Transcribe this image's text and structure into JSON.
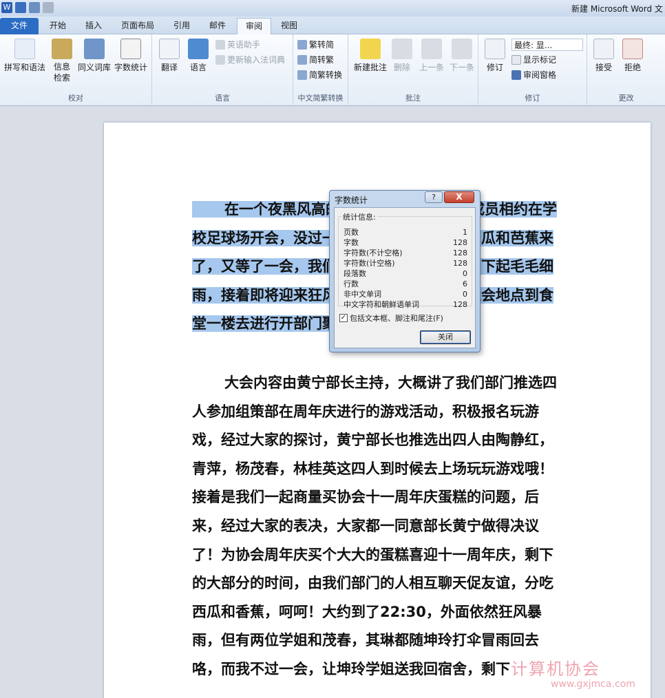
{
  "window": {
    "title": "新建 Microsoft Word 文",
    "app_icon": "W"
  },
  "tabs": [
    "文件",
    "开始",
    "插入",
    "页面布局",
    "引用",
    "邮件",
    "审阅",
    "视图"
  ],
  "ribbon": {
    "proofing": {
      "label": "校对",
      "spelling": "拼写和语法",
      "research": "信息\n检索",
      "thesaurus": "同义词库",
      "wordcount": "字数统计"
    },
    "language": {
      "label": "语言",
      "translate": "翻译",
      "language": "语言",
      "english_assistant": "英语助手",
      "update_ime": "更新输入法词典"
    },
    "chinese": {
      "label": "中文简繁转换",
      "trad_to_simp": "繁转简",
      "simp_to_trad": "简转繁",
      "convert": "简繁转换"
    },
    "comments": {
      "label": "批注",
      "new": "新建批注",
      "delete": "删除",
      "prev": "上一条",
      "next": "下一条"
    },
    "tracking": {
      "label": "修订",
      "track": "修订",
      "final": "最终: 显...",
      "show_markup": "显示标记",
      "review_pane": "审阅窗格"
    },
    "changes": {
      "label": "更改",
      "accept": "接受",
      "reject": "拒绝"
    }
  },
  "document": {
    "p1": "在一个夜黑风高的晚上，我们部门部门成员相约在学校足球场开会，没过一会儿，部长黄宁提着西瓜和芭蕉来了，又等了一会，我们部门人都到齐了，天空下起毛毛细雨，接着即将迎来狂风暴雨，部长临时改变聚会地点到食堂一楼去进行开部门聚会开会。",
    "p2": "大会内容由黄宁部长主持，大概讲了我们部门推选四人参加组策部在周年庆进行的游戏活动，积极报名玩游戏，经过大家的探讨，黄宁部长也推选出四人由陶静红，青萍，杨茂春，林桂英这四人到时候去上场玩玩游戏哦！接着是我们一起商量买协会十一周年庆蛋糕的问题，后来，经过大家的表决，大家都一同意部长黄宁做得决议了！为协会周年庆买个大大的蛋糕喜迎十一周年庆，剩下的大部分的时间，由我们部门的人相互聊天促友谊，分吃西瓜和香蕉，呵呵！大约到了22:30，外面依然狂风暴雨，但有两位学姐和茂春，其琳都随坤玲打伞冒雨回去咯，而我不过一会，让坤玲学姐送我回宿舍，剩下"
  },
  "dialog": {
    "title": "字数统计",
    "help": "?",
    "close_x": "X",
    "section": "统计信息:",
    "stats": [
      {
        "label": "页数",
        "value": "1"
      },
      {
        "label": "字数",
        "value": "128"
      },
      {
        "label": "字符数(不计空格)",
        "value": "128"
      },
      {
        "label": "字符数(计空格)",
        "value": "128"
      },
      {
        "label": "段落数",
        "value": "0"
      },
      {
        "label": "行数",
        "value": "6"
      },
      {
        "label": "非中文单词",
        "value": "0"
      },
      {
        "label": "中文字符和朝鲜语单词",
        "value": "128"
      }
    ],
    "checkbox": "包括文本框、脚注和尾注(F)",
    "close_button": "关闭"
  },
  "watermark": {
    "name": "计算机协会",
    "url": "www.gxjmca.com"
  },
  "colors": {
    "selection": "#a6c8ee",
    "file_tab": "#2b6cc4",
    "accent": "#3d7bd6"
  }
}
